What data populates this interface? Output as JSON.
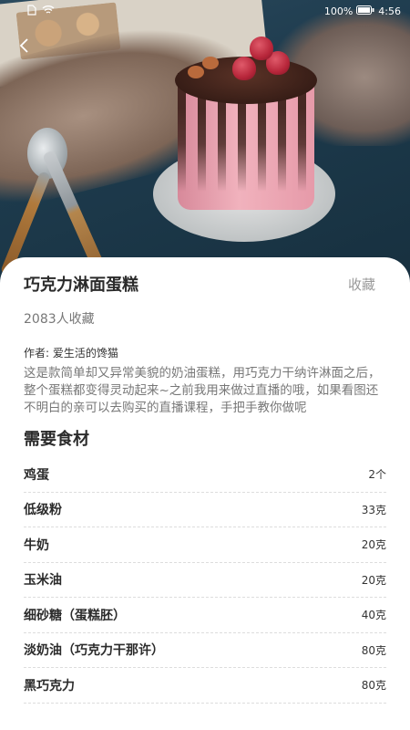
{
  "status_bar": {
    "battery_text": "100%",
    "time": "4:56"
  },
  "recipe": {
    "title": "巧克力淋面蛋糕",
    "favorite_label": "收藏",
    "favorite_count": "2083人收藏",
    "author": "作者: 爱生活的馋猫",
    "description": "这是款简单却又异常美貌的奶油蛋糕，用巧克力干纳许淋面之后，整个蛋糕都变得灵动起来~之前我用来做过直播的哦，如果看图还不明白的亲可以去购买的直播课程，手把手教你做呢"
  },
  "ingredients": {
    "section_title": "需要食材",
    "items": [
      {
        "name": "鸡蛋",
        "amount": "2个"
      },
      {
        "name": "低级粉",
        "amount": "33克"
      },
      {
        "name": "牛奶",
        "amount": "20克"
      },
      {
        "name": "玉米油",
        "amount": "20克"
      },
      {
        "name": "细砂糖（蛋糕胚）",
        "amount": "40克"
      },
      {
        "name": "淡奶油（巧克力干那许）",
        "amount": "80克"
      },
      {
        "name": "黑巧克力",
        "amount": "80克"
      }
    ]
  },
  "icons": {
    "back": "back-arrow-icon",
    "sim": "sim-card-icon",
    "wifi": "wifi-icon",
    "battery": "battery-icon"
  }
}
